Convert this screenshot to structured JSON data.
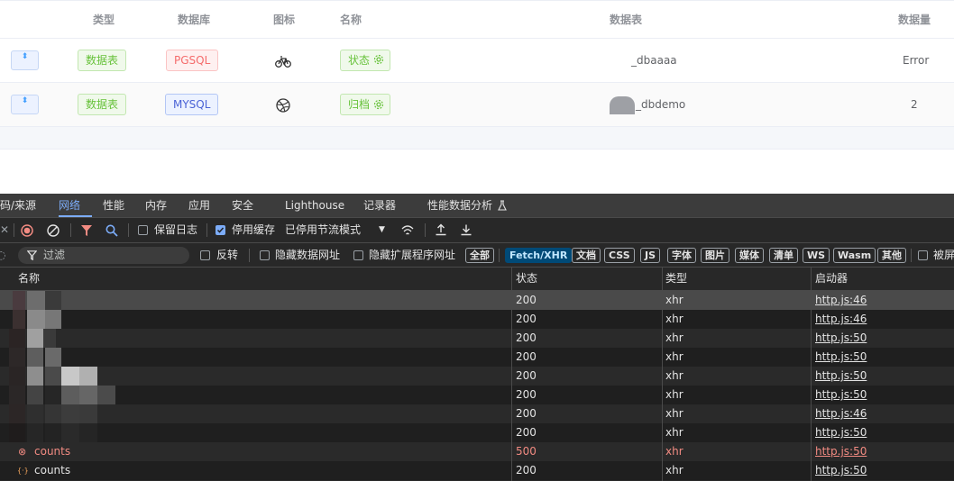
{
  "table": {
    "headers": [
      "类型",
      "数据库",
      "图标",
      "名称",
      "数据表",
      "数据量"
    ],
    "rows": [
      {
        "type": "数据表",
        "db": "PGSQL",
        "icon": "bicycle-icon",
        "name": "状态",
        "table": "_dbaaaa",
        "count": "Error"
      },
      {
        "type": "数据表",
        "db": "MYSQL",
        "icon": "dribbble-icon",
        "name": "归档",
        "table": "_dbdemo",
        "count": "2"
      }
    ],
    "sort_glyph": "⬍"
  },
  "devtools": {
    "tabs": [
      "码/来源",
      "网络",
      "性能",
      "内存",
      "应用",
      "安全",
      "Lighthouse",
      "记录器",
      "性能数据分析"
    ],
    "active_tab": "网络",
    "toolbar": {
      "preserve_log": "保留日志",
      "disable_cache": "停用缓存",
      "throttle": "已停用节流模式"
    },
    "filter": {
      "placeholder": "过滤",
      "invert": "反转",
      "hide_data_urls": "隐藏数据网址",
      "hide_ext_urls": "隐藏扩展程序网址",
      "types": [
        "全部",
        "Fetch/XHR",
        "文档",
        "CSS",
        "JS",
        "字体",
        "图片",
        "媒体",
        "清单",
        "WS",
        "Wasm",
        "其他"
      ],
      "active_type": "Fetch/XHR",
      "blocked": "被屏"
    },
    "columns": [
      "名称",
      "状态",
      "类型",
      "启动器"
    ],
    "requests": [
      {
        "name": "",
        "status": "200",
        "type": "xhr",
        "initiator": "http.js:46"
      },
      {
        "name": "",
        "status": "200",
        "type": "xhr",
        "initiator": "http.js:46"
      },
      {
        "name": "",
        "status": "200",
        "type": "xhr",
        "initiator": "http.js:50"
      },
      {
        "name": "",
        "status": "200",
        "type": "xhr",
        "initiator": "http.js:50"
      },
      {
        "name": "",
        "status": "200",
        "type": "xhr",
        "initiator": "http.js:50"
      },
      {
        "name": "",
        "status": "200",
        "type": "xhr",
        "initiator": "http.js:50"
      },
      {
        "name": "",
        "status": "200",
        "type": "xhr",
        "initiator": "http.js:46"
      },
      {
        "name": "",
        "status": "200",
        "type": "xhr",
        "initiator": "http.js:50"
      },
      {
        "name": "counts",
        "status": "500",
        "type": "xhr",
        "initiator": "http.js:50",
        "error": true
      },
      {
        "name": "counts",
        "status": "200",
        "type": "xhr",
        "initiator": "http.js:50"
      }
    ]
  },
  "colors": {
    "tag_green": "#67c23a",
    "tag_red": "#f56c6c",
    "tag_blue": "#4b63d6",
    "devtools_bg": "#282828",
    "devtools_accent": "#7cacf8",
    "error": "#f28b82"
  }
}
